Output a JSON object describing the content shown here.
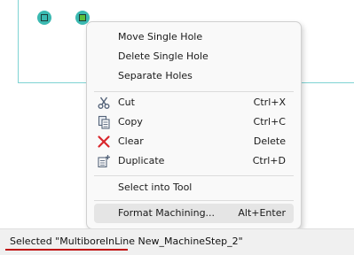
{
  "context_menu": {
    "items": [
      {
        "label": "Move Single Hole"
      },
      {
        "label": "Delete Single Hole"
      },
      {
        "label": "Separate Holes"
      },
      {
        "label": "Cut",
        "shortcut": "Ctrl+X",
        "icon": "scissors-icon"
      },
      {
        "label": "Copy",
        "shortcut": "Ctrl+C",
        "icon": "copy-icon"
      },
      {
        "label": "Clear",
        "shortcut": "Delete",
        "icon": "red-x-icon"
      },
      {
        "label": "Duplicate",
        "shortcut": "Ctrl+D",
        "icon": "duplicate-icon"
      },
      {
        "label": "Select into Tool"
      },
      {
        "label": "Format Machining...",
        "shortcut": "Alt+Enter",
        "highlighted": true
      }
    ]
  },
  "status_bar": {
    "text": "Selected \"MultiboreInLine New_MachineStep_2\""
  },
  "colors": {
    "hole_fill": "#3bb9b1",
    "selected_hole_marker": "#5cbf3a",
    "clear_icon": "#d9262c",
    "status_underline": "#c01010",
    "panel_edge": "#7fd3d3"
  }
}
